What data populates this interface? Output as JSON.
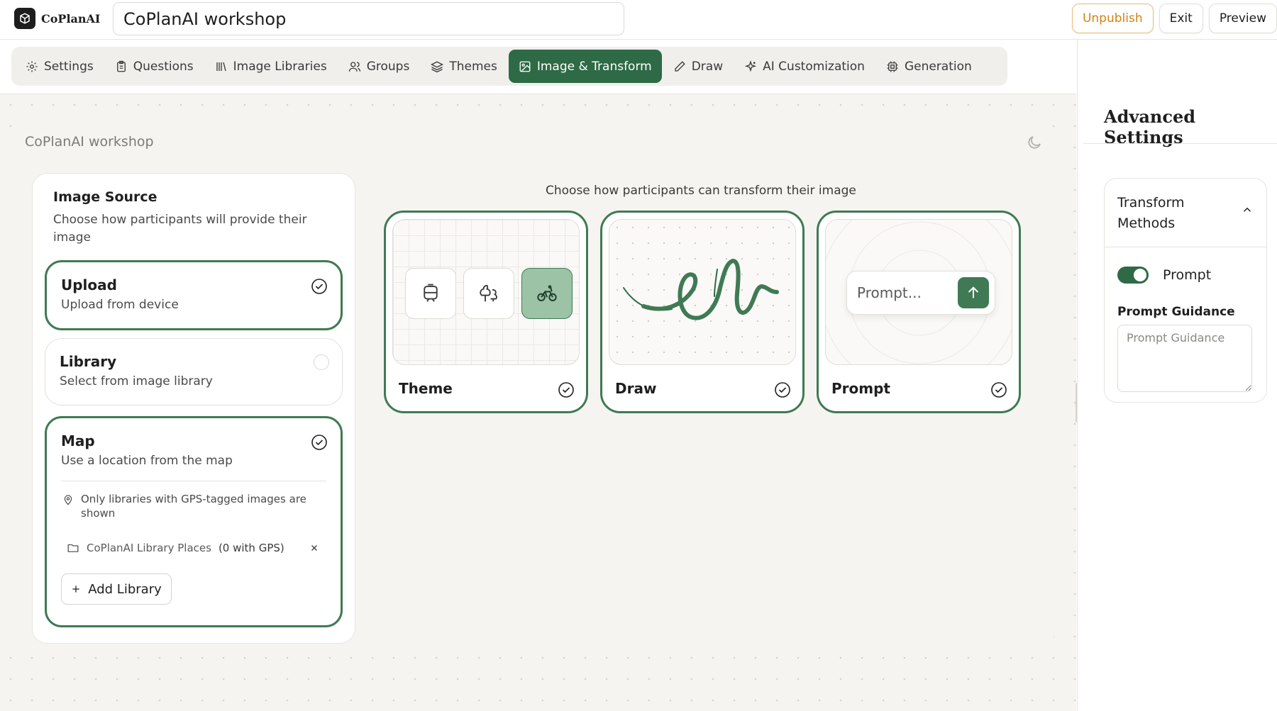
{
  "app": {
    "brand": "CoPlanAI",
    "title": "CoPlanAI workshop"
  },
  "actions": {
    "unpublish": "Unpublish",
    "exit": "Exit",
    "preview": "Preview"
  },
  "tabs": [
    {
      "label": "Settings",
      "icon": "gear-icon"
    },
    {
      "label": "Questions",
      "icon": "clipboard-icon"
    },
    {
      "label": "Image Libraries",
      "icon": "library-icon"
    },
    {
      "label": "Groups",
      "icon": "users-icon"
    },
    {
      "label": "Themes",
      "icon": "layers-icon"
    },
    {
      "label": "Image & Transform",
      "icon": "image-icon",
      "active": true
    },
    {
      "label": "Draw",
      "icon": "pencil-icon"
    },
    {
      "label": "AI Customization",
      "icon": "sparkles-icon"
    },
    {
      "label": "Generation",
      "icon": "cpu-icon"
    }
  ],
  "board": {
    "title": "CoPlanAI workshop"
  },
  "image_source": {
    "title": "Image Source",
    "subtitle": "Choose how participants will provide their image",
    "options": [
      {
        "title": "Upload",
        "subtitle": "Upload from device",
        "selected": true
      },
      {
        "title": "Library",
        "subtitle": "Select from image library",
        "selected": false
      },
      {
        "title": "Map",
        "subtitle": "Use a location from the map",
        "selected": true
      }
    ],
    "map_note": "Only libraries with GPS-tagged images are shown",
    "library_name": "CoPlanAI Library Places",
    "library_gps": "(0 with GPS)",
    "add_library": "Add Library"
  },
  "transform": {
    "heading": "Choose how participants can transform their image",
    "cards": [
      {
        "label": "Theme",
        "checked": true
      },
      {
        "label": "Draw",
        "checked": true
      },
      {
        "label": "Prompt",
        "checked": true,
        "placeholder": "Prompt..."
      }
    ]
  },
  "advanced": {
    "title": "Advanced Settings",
    "section": "Transform Methods",
    "toggle_label": "Prompt",
    "toggle_on": true,
    "guidance_label": "Prompt Guidance",
    "guidance_placeholder": "Prompt Guidance"
  },
  "colors": {
    "accent": "#2d6a45",
    "warning": "#d08212",
    "background": "#f5f4f1"
  }
}
